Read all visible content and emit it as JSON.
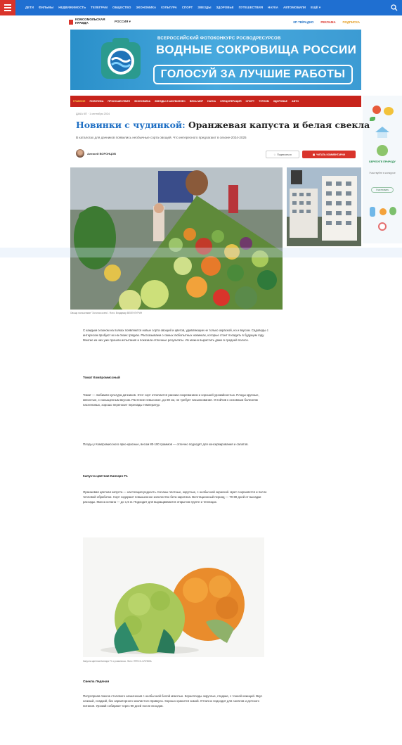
{
  "nav": {
    "links": [
      "ДЕТИ",
      "ФИЛЬМЫ",
      "НЕДВИЖИМОСТЬ",
      "ТЕЛЕГРАМ",
      "ОБЩЕСТВО",
      "ЭКОНОМИКА",
      "КУЛЬТУРА",
      "СПОРТ",
      "ЗВЕЗДЫ",
      "ЗДОРОВЬЕ",
      "ПУТЕШЕСТВИЯ",
      "НАУКА",
      "АВТОМОБИЛИ",
      "ЕЩЁ ▾"
    ]
  },
  "header": {
    "logo_text": "КОМСОМОЛЬСКАЯ ПРАВДА",
    "region": "РОССИЯ ▾",
    "right": [
      "КП ТВ/РАДИО",
      "РЕКЛАМА",
      "ПОДПИСКА"
    ]
  },
  "banner": {
    "subtitle": "ВСЕРОССИЙСКИЙ ФОТОКОНКУРС РОСВОДРЕСУРСОВ",
    "title": "ВОДНЫЕ СОКРОВИЩА РОССИИ",
    "cta": "ГОЛОСУЙ ЗА ЛУЧШИЕ РАБОТЫ"
  },
  "rubrics": [
    "ГЛАВНОЕ",
    "ПОЛИТИКА",
    "ПРОИСШЕСТВИЯ",
    "ЭКОНОМИКА",
    "ЗВЕЗДЫ И ШОУБИЗНЕС",
    "ВЕСЬ МИР",
    "НАУКА",
    "СПЕЦОПЕРАЦИЯ",
    "СПОРТ",
    "ТУРИЗМ",
    "ЗДОРОВЬЕ",
    "АВТО"
  ],
  "rail": {
    "promo_text": "БЕРЕГИТЕ ПРИРОДУ",
    "promo_sub": "Участвуйте в конкурсе",
    "button": "Участвовать"
  },
  "article": {
    "breadcrumb": "ДАЧА КП · 1 сентября 2024",
    "title_highlight": "Новинки с чудинкой:",
    "title_rest": " Оранжевая капуста и белая свекла",
    "lead": "В каталогах для дачников появились необычные сорта овощей. Что интересного предлагают в сезоне-2024-2025",
    "author": "Алексей ВОРОНЦОВ",
    "subscribe_btn": "Подписаться",
    "read_btn": "ЧИТАТЬ КОММЕНТАРИИ",
    "caption1": "Овощи на выставке \"Золотая осень\".\nФото: Владимир ВЕЛЕНГУРИН",
    "p1": "С каждым сезоном на полках появляются новые сорта овощей и цветов, удивляющие не только окраской, но и вкусом. Садоводы с интересом пробуют их на своих грядках. Рассказываем о самых любопытных новинках, которые стоит посадить в будущем году. Многие из них уже прошли испытания и показали отличные результаты. Их можно вырастить даже в средней полосе.",
    "h1": "Томат Компромиссный",
    "p2": "Томат — любимая культура дачников. Этот сорт отличается ранним созреванием и хорошей урожайностью. Плоды крупные, мясистые, с насыщенным вкусом. Растение невысокое, до 80 см, не требует пасынкования. Устойчив к основным болезням пасленовых, хорошо переносит перепады температур.",
    "p3": "Плоды у Компромиссного ярко-красные, весом 80-100 граммов — отлично подходят для консервирования и салатов.",
    "h2": "Капуста цветная Кангаро F1",
    "p4": "Оранжевая цветная капуста — настоящая редкость. Кочаны плотные, округлые, с необычной окраской. Цвет сохраняется и после тепловой обработки. Сорт содержит повышенное количество бета-каротина. Вегетационный период — 70-80 дней от высадки рассады. Масса кочана — до 1,5 кг. Подходит для выращивания в открытом грунте и теплицах.",
    "caption2": "Капуста цветная Кангаро F1 и романеско.\nФото: ПРЕСС-СЛУЖБА",
    "h3": "Свекла Ледяная",
    "p5": "Популярная свекла столового назначения с необычной белой мякотью. Корнеплоды округлые, гладкие, с тонкой кожицей. Вкус нежный, сладкий, без характерного землистого привкуса. Хорошо хранится зимой. Отлично подходит для салатов и детского питания. Урожай собирают через 90 дней после всходов."
  }
}
